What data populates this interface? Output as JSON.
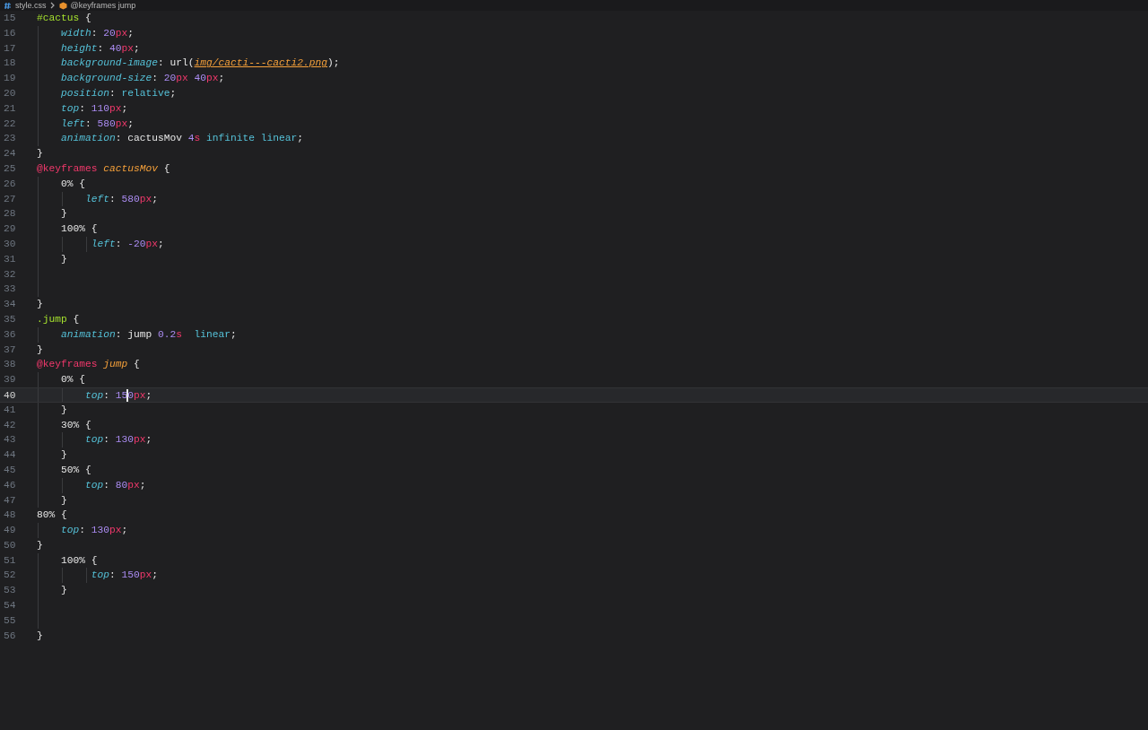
{
  "breadcrumb": [
    {
      "kind": "css",
      "text": "style.css"
    },
    {
      "kind": "keyframes",
      "text": "@keyframes jump"
    }
  ],
  "lines": [
    {
      "number": "15",
      "tokens": [
        {
          "kind": "sel",
          "text": "#cactus"
        },
        {
          "kind": "punct",
          "text": " {"
        }
      ]
    },
    {
      "number": "16",
      "tokens": [
        {
          "kind": "prop",
          "text": "    width"
        },
        {
          "kind": "punct",
          "text": ": "
        },
        {
          "kind": "num",
          "text": "20"
        },
        {
          "kind": "unit",
          "text": "px"
        },
        {
          "kind": "punct",
          "text": ";"
        }
      ]
    },
    {
      "number": "17",
      "tokens": [
        {
          "kind": "prop",
          "text": "    height"
        },
        {
          "kind": "punct",
          "text": ": "
        },
        {
          "kind": "num",
          "text": "40"
        },
        {
          "kind": "unit",
          "text": "px"
        },
        {
          "kind": "punct",
          "text": ";"
        }
      ]
    },
    {
      "number": "18",
      "tokens": [
        {
          "kind": "prop",
          "text": "    background-image"
        },
        {
          "kind": "punct",
          "text": ": "
        },
        {
          "kind": "plain",
          "text": "url("
        },
        {
          "kind": "url",
          "text": "img/cacti---cacti2.png"
        },
        {
          "kind": "punct",
          "text": ");"
        }
      ]
    },
    {
      "number": "19",
      "tokens": [
        {
          "kind": "prop",
          "text": "    background-size"
        },
        {
          "kind": "punct",
          "text": ": "
        },
        {
          "kind": "num",
          "text": "20"
        },
        {
          "kind": "unit",
          "text": "px"
        },
        {
          "kind": "num",
          "text": " 40"
        },
        {
          "kind": "unit",
          "text": "px"
        },
        {
          "kind": "punct",
          "text": ";"
        }
      ]
    },
    {
      "number": "20",
      "tokens": [
        {
          "kind": "prop",
          "text": "    position"
        },
        {
          "kind": "punct",
          "text": ": "
        },
        {
          "kind": "ident",
          "text": "relative"
        },
        {
          "kind": "punct",
          "text": ";"
        }
      ]
    },
    {
      "number": "21",
      "tokens": [
        {
          "kind": "prop",
          "text": "    top"
        },
        {
          "kind": "punct",
          "text": ": "
        },
        {
          "kind": "num",
          "text": "110"
        },
        {
          "kind": "unit",
          "text": "px"
        },
        {
          "kind": "punct",
          "text": ";"
        }
      ]
    },
    {
      "number": "22",
      "tokens": [
        {
          "kind": "prop",
          "text": "    left"
        },
        {
          "kind": "punct",
          "text": ": "
        },
        {
          "kind": "num",
          "text": "580"
        },
        {
          "kind": "unit",
          "text": "px"
        },
        {
          "kind": "punct",
          "text": ";"
        }
      ]
    },
    {
      "number": "23",
      "tokens": [
        {
          "kind": "prop",
          "text": "    animation"
        },
        {
          "kind": "punct",
          "text": ": "
        },
        {
          "kind": "plain",
          "text": "cactusMov "
        },
        {
          "kind": "num",
          "text": "4"
        },
        {
          "kind": "unit",
          "text": "s"
        },
        {
          "kind": "ident",
          "text": " infinite linear"
        },
        {
          "kind": "punct",
          "text": ";"
        }
      ]
    },
    {
      "number": "24",
      "tokens": [
        {
          "kind": "punct",
          "text": "}"
        }
      ]
    },
    {
      "number": "25",
      "tokens": [
        {
          "kind": "at",
          "text": "@keyframes"
        },
        {
          "kind": "name",
          "text": " cactusMov"
        },
        {
          "kind": "punct",
          "text": " {"
        }
      ]
    },
    {
      "number": "26",
      "tokens": [
        {
          "kind": "plain",
          "text": "    0% {"
        }
      ]
    },
    {
      "number": "27",
      "tokens": [
        {
          "kind": "prop",
          "text": "        left"
        },
        {
          "kind": "punct",
          "text": ": "
        },
        {
          "kind": "num",
          "text": "580"
        },
        {
          "kind": "unit",
          "text": "px"
        },
        {
          "kind": "punct",
          "text": ";"
        }
      ]
    },
    {
      "number": "28",
      "tokens": [
        {
          "kind": "punct",
          "text": "    }"
        }
      ]
    },
    {
      "number": "29",
      "tokens": [
        {
          "kind": "plain",
          "text": "    100% {"
        }
      ]
    },
    {
      "number": "30",
      "tokens": [
        {
          "kind": "prop",
          "text": "         left"
        },
        {
          "kind": "punct",
          "text": ": "
        },
        {
          "kind": "num",
          "text": "-20"
        },
        {
          "kind": "unit",
          "text": "px"
        },
        {
          "kind": "punct",
          "text": ";"
        }
      ]
    },
    {
      "number": "31",
      "tokens": [
        {
          "kind": "punct",
          "text": "    }"
        }
      ]
    },
    {
      "number": "32",
      "guide": true
    },
    {
      "number": "33",
      "guide": true
    },
    {
      "number": "34",
      "tokens": [
        {
          "kind": "punct",
          "text": "}"
        }
      ]
    },
    {
      "number": "35",
      "tokens": [
        {
          "kind": "sel",
          "text": ".jump"
        },
        {
          "kind": "punct",
          "text": " {"
        }
      ]
    },
    {
      "number": "36",
      "tokens": [
        {
          "kind": "prop",
          "text": "    animation"
        },
        {
          "kind": "punct",
          "text": ": "
        },
        {
          "kind": "plain",
          "text": "jump "
        },
        {
          "kind": "num",
          "text": "0.2"
        },
        {
          "kind": "unit",
          "text": "s"
        },
        {
          "kind": "ident",
          "text": "  linear"
        },
        {
          "kind": "punct",
          "text": ";"
        }
      ]
    },
    {
      "number": "37",
      "tokens": [
        {
          "kind": "punct",
          "text": "}"
        }
      ]
    },
    {
      "number": "38",
      "tokens": [
        {
          "kind": "at",
          "text": "@keyframes"
        },
        {
          "kind": "name",
          "text": " jump"
        },
        {
          "kind": "punct",
          "text": " {"
        }
      ]
    },
    {
      "number": "39",
      "tokens": [
        {
          "kind": "plain",
          "text": "    0% {"
        }
      ]
    },
    {
      "number": "40",
      "current": true,
      "tokens": [
        {
          "kind": "prop",
          "text": "        top"
        },
        {
          "kind": "punct",
          "text": ": "
        },
        {
          "kind": "num",
          "text": "15",
          "cursor_after": true
        },
        {
          "kind": "num",
          "text": "0"
        },
        {
          "kind": "unit",
          "text": "px"
        },
        {
          "kind": "punct",
          "text": ";"
        }
      ]
    },
    {
      "number": "41",
      "tokens": [
        {
          "kind": "punct",
          "text": "    }"
        }
      ]
    },
    {
      "number": "42",
      "tokens": [
        {
          "kind": "plain",
          "text": "    30% {"
        }
      ]
    },
    {
      "number": "43",
      "tokens": [
        {
          "kind": "prop",
          "text": "        top"
        },
        {
          "kind": "punct",
          "text": ": "
        },
        {
          "kind": "num",
          "text": "130"
        },
        {
          "kind": "unit",
          "text": "px"
        },
        {
          "kind": "punct",
          "text": ";"
        }
      ]
    },
    {
      "number": "44",
      "tokens": [
        {
          "kind": "punct",
          "text": "    }"
        }
      ]
    },
    {
      "number": "45",
      "tokens": [
        {
          "kind": "plain",
          "text": "    50% {"
        }
      ]
    },
    {
      "number": "46",
      "tokens": [
        {
          "kind": "prop",
          "text": "        top"
        },
        {
          "kind": "punct",
          "text": ": "
        },
        {
          "kind": "num",
          "text": "80"
        },
        {
          "kind": "unit",
          "text": "px"
        },
        {
          "kind": "punct",
          "text": ";"
        }
      ]
    },
    {
      "number": "47",
      "tokens": [
        {
          "kind": "punct",
          "text": "    }"
        }
      ]
    },
    {
      "number": "48",
      "tokens": [
        {
          "kind": "plain",
          "text": "80% {"
        }
      ]
    },
    {
      "number": "49",
      "tokens": [
        {
          "kind": "prop",
          "text": "    top"
        },
        {
          "kind": "punct",
          "text": ": "
        },
        {
          "kind": "num",
          "text": "130"
        },
        {
          "kind": "unit",
          "text": "px"
        },
        {
          "kind": "punct",
          "text": ";"
        }
      ]
    },
    {
      "number": "50",
      "tokens": [
        {
          "kind": "punct",
          "text": "}"
        }
      ]
    },
    {
      "number": "51",
      "tokens": [
        {
          "kind": "plain",
          "text": "    100% {"
        }
      ]
    },
    {
      "number": "52",
      "tokens": [
        {
          "kind": "prop",
          "text": "         top"
        },
        {
          "kind": "punct",
          "text": ": "
        },
        {
          "kind": "num",
          "text": "150"
        },
        {
          "kind": "unit",
          "text": "px"
        },
        {
          "kind": "punct",
          "text": ";"
        }
      ]
    },
    {
      "number": "53",
      "tokens": [
        {
          "kind": "punct",
          "text": "    }"
        }
      ]
    },
    {
      "number": "54",
      "guide": true
    },
    {
      "number": "55",
      "guide": true
    },
    {
      "number": "56",
      "tokens": [
        {
          "kind": "punct",
          "text": "}"
        }
      ]
    }
  ]
}
